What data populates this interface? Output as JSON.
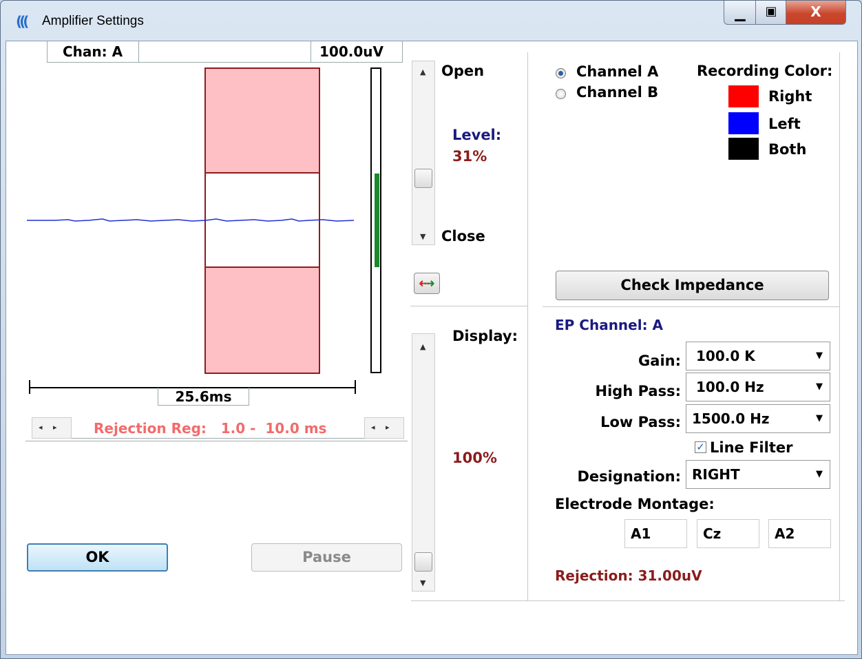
{
  "window": {
    "title": "Amplifier Settings",
    "minimize": "–",
    "maximize": "▢",
    "close": "X"
  },
  "trace": {
    "channel_label": "Chan: A",
    "scale_label": "100.0uV",
    "time_label": "25.6ms",
    "rejection_region": "Rejection Reg:   1.0 -  10.0 ms",
    "level_meter_fraction": 0.31
  },
  "level_slider": {
    "open_label": "Open",
    "close_label": "Close",
    "level_label": "Level:",
    "level_value": "31%"
  },
  "display_slider": {
    "label": "Display:",
    "value": "100%"
  },
  "channel_select": {
    "options": [
      "Channel A",
      "Channel B"
    ],
    "selected": "Channel A"
  },
  "recording_color": {
    "title": "Recording Color:",
    "items": [
      {
        "label": "Right",
        "color": "#ff0000"
      },
      {
        "label": "Left",
        "color": "#0000ff"
      },
      {
        "label": "Both",
        "color": "#000000"
      }
    ]
  },
  "check_impedance_label": "Check Impedance",
  "ep": {
    "title": "EP Channel: A",
    "gain_label": "Gain:",
    "gain_value": "100.0 K",
    "high_pass_label": "High Pass:",
    "high_pass_value": "100.0 Hz",
    "low_pass_label": "Low Pass:",
    "low_pass_value": "1500.0 Hz",
    "line_filter_label": "Line Filter",
    "line_filter_checked": true,
    "designation_label": "Designation:",
    "designation_value": "RIGHT",
    "montage_label": "Electrode Montage:",
    "montage": [
      "A1",
      "Cz",
      "A2"
    ],
    "rejection": "Rejection: 31.00uV"
  },
  "buttons": {
    "ok": "OK",
    "pause": "Pause"
  },
  "colors": {
    "trace": "#1f2fd1",
    "reject_fill": "#ffc0c5",
    "reject_border": "#8b1c1c",
    "level_text": "#8b1c1c",
    "label_blue": "#1a1a80",
    "meter": "#1a8a2a"
  }
}
